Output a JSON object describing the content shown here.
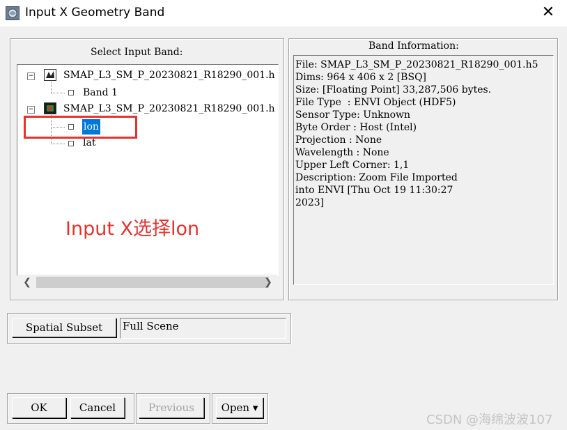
{
  "window": {
    "title": "Input X Geometry Band",
    "close_glyph": "✕"
  },
  "select_panel": {
    "label": "Select Input Band:",
    "tree": [
      {
        "label": "SMAP_L3_SM_P_20230821_R18290_001.h",
        "children": [
          "Band 1"
        ]
      },
      {
        "label": "SMAP_L3_SM_P_20230821_R18290_001.h",
        "children": [
          "lon",
          "lat"
        ]
      }
    ],
    "selected": "lon",
    "scroll_left": "❮",
    "scroll_right": "❯"
  },
  "info_panel": {
    "label": "Band Information:",
    "lines": [
      "File: SMAP_L3_SM_P_20230821_R18290_001.h5",
      "Dims: 964 x 406 x 2 [BSQ]",
      "Size: [Floating Point] 33,287,506 bytes.",
      "File Type  : ENVI Object (HDF5)",
      "Sensor Type: Unknown",
      "Byte Order : Host (Intel)",
      "Projection : None",
      "Wavelength : None",
      "Upper Left Corner: 1,1",
      "Description: Zoom File Imported",
      "into ENVI [Thu Oct 19 11:30:27",
      "2023]"
    ]
  },
  "subset": {
    "button_label": "Spatial Subset",
    "value": "Full Scene"
  },
  "buttons": {
    "ok": "OK",
    "cancel": "Cancel",
    "previous": "Previous",
    "open": "Open ▾"
  },
  "annotation": {
    "text": "Input X选择lon",
    "color": "#e8322e"
  },
  "watermark": "CSDN @海绵波波107"
}
